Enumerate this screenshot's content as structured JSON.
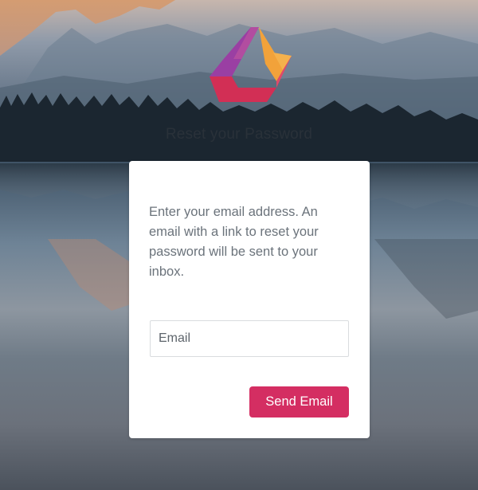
{
  "page": {
    "title": "Reset your Password"
  },
  "logo": {
    "icon": "brand-triangle-logo",
    "colors": {
      "purple": "#9a3fa3",
      "orange": "#f2a23a",
      "red": "#d22f55"
    }
  },
  "form": {
    "description": "Enter your email address. An email with a link to reset your password will be sent to your inbox.",
    "email_placeholder": "Email",
    "email_value": "",
    "submit_label": "Send Email",
    "submit_color": "#d42e62"
  }
}
